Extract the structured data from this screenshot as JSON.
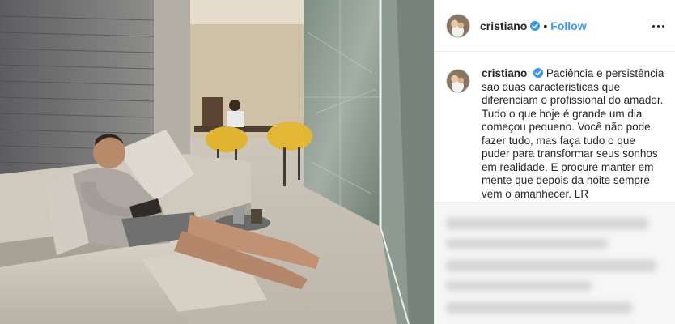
{
  "post": {
    "photo_icon": "photo-of-man-reading-on-sofa"
  },
  "header": {
    "username": "cristiano",
    "verified_icon": "verified-badge-icon",
    "separator": "•",
    "follow_label": "Follow",
    "more_icon": "more-options-icon"
  },
  "caption": {
    "username": "cristiano",
    "text": "Paciência e persistência sao duas caracteristicas que diferenciam o profissional do amador. Tudo o que hoje é grande um dia começou pequeno. Você não pode fazer tudo, mas faça tudo o que puder para transformar seus sonhos em realidade. E procure manter em mente que depois da noite sempre vem o amanhecer. LR"
  },
  "colors": {
    "accent": "#3897f0",
    "verified": "#3897f0",
    "text": "#262626"
  }
}
